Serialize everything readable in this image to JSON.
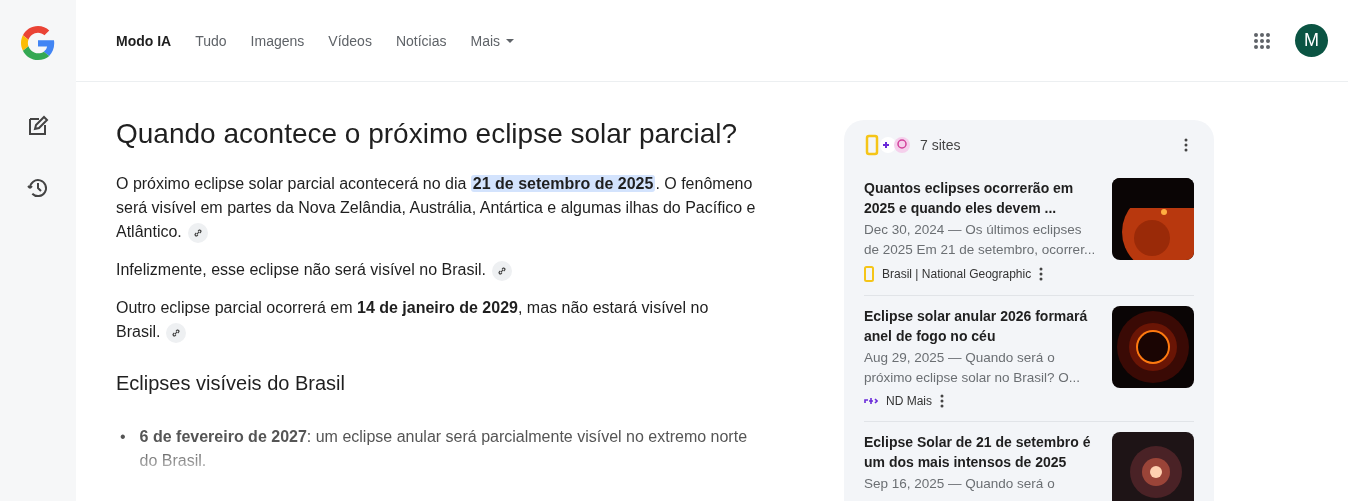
{
  "nav": {
    "tabs": [
      {
        "label": "Modo IA",
        "selected": true
      },
      {
        "label": "Tudo",
        "selected": false
      },
      {
        "label": "Imagens",
        "selected": false
      },
      {
        "label": "Vídeos",
        "selected": false
      },
      {
        "label": "Notícias",
        "selected": false
      },
      {
        "label": "Mais",
        "selected": false,
        "kind": "dropdown"
      }
    ],
    "avatar": "M"
  },
  "answer": {
    "title": "Quando acontece o próximo eclipse solar parcial?",
    "paragraphs": [
      {
        "parts": [
          {
            "text": "O próximo eclipse solar parcial acontecerá no dia ",
            "kind": "plain"
          },
          {
            "text": "21 de setembro de 2025",
            "kind": "highlight"
          },
          {
            "text": ". O fenômeno será visível em partes da Nova Zelândia, Austrália, Antártica e algumas ilhas do Pacífico e Atlântico.",
            "kind": "plain"
          }
        ]
      },
      {
        "parts": [
          {
            "text": "Infelizmente, esse eclipse não será visível no Brasil.",
            "kind": "plain"
          }
        ]
      },
      {
        "parts": [
          {
            "text": "Outro eclipse parcial ocorrerá em ",
            "kind": "plain"
          },
          {
            "text": "14 de janeiro de 2029",
            "kind": "bold"
          },
          {
            "text": ", mas não estará visível no Brasil.",
            "kind": "plain"
          }
        ]
      }
    ],
    "section_heading": "Eclipses visíveis do Brasil",
    "bullets": [
      {
        "marker": "•",
        "text": "**6 de fevereiro de 2027**: um eclipse anular será parcialmente visível no extremo norte do Brasil."
      }
    ]
  },
  "sources": {
    "count": "7 sites",
    "items": [
      {
        "title": "Quantos eclipses ocorrerão em 2025 e quando eles devem ...",
        "snippet": "Dec 30, 2024 — Os últimos eclipses de 2025 Em 21 de setembro, ocorrer...",
        "source": "Brasil | National Geographic"
      },
      {
        "title": "Eclipse solar anular 2026 formará anel de fogo no céu",
        "snippet": "Aug 29, 2025 — Quando será o próximo eclipse solar no Brasil? O...",
        "source": "ND Mais"
      },
      {
        "title": "Eclipse Solar de 21 de setembro é um dos mais intensos de 2025",
        "snippet": "Sep 16, 2025 — Quando será o"
      }
    ]
  }
}
